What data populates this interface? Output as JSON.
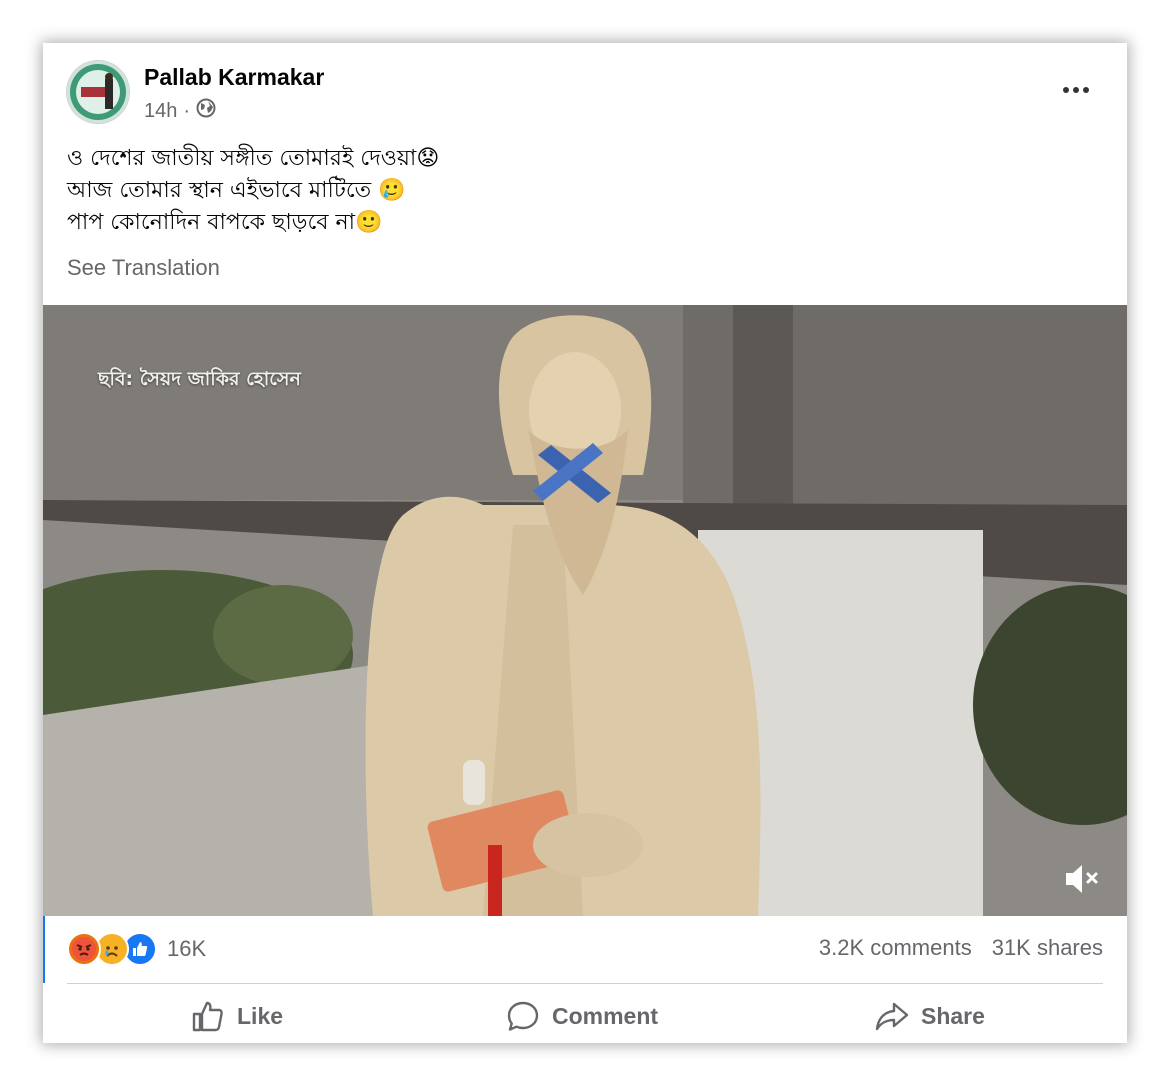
{
  "post": {
    "author": "Pallab Karmakar",
    "time": "14h",
    "time_separator": "·",
    "lines": [
      "ও দেশের জাতীয় সঙ্গীত তোমারই দেওয়া😟",
      "আজ তোমার স্থান এইভাবে মাটিতে 🥲",
      "পাপ কোনোদিন বাপকে ছাড়বে না🙂"
    ],
    "see_translation": "See Translation"
  },
  "media": {
    "watermark": "ছবি: সৈয়দ জাকির হোসেন"
  },
  "reactions": {
    "icons": [
      "angry-icon",
      "sad-icon",
      "like-icon"
    ],
    "count": "16K"
  },
  "stats": {
    "comments": "3.2K comments",
    "shares": "31K shares"
  },
  "actions": {
    "like": "Like",
    "comment": "Comment",
    "share": "Share"
  },
  "colors": {
    "like_blue": "#1877f2",
    "angry": "#e9710f",
    "sad": "#f7b125",
    "secondary_text": "#65676b"
  }
}
